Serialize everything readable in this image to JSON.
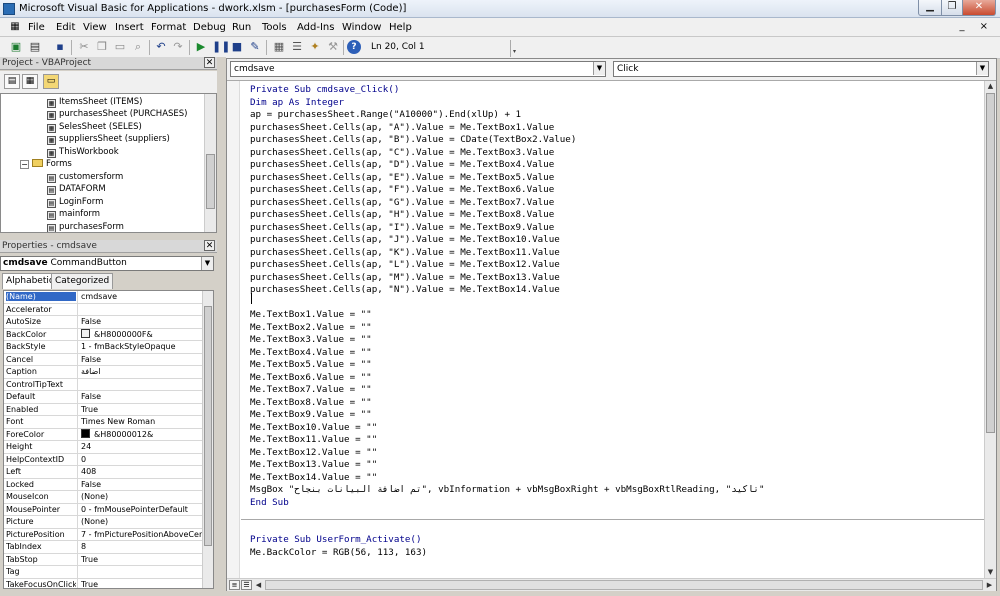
{
  "window": {
    "title": "Microsoft Visual Basic for Applications - dwork.xlsm - [purchasesForm (Code)]"
  },
  "menu": {
    "items": [
      "File",
      "Edit",
      "View",
      "Insert",
      "Format",
      "Debug",
      "Run",
      "Tools",
      "Add-Ins",
      "Window",
      "Help"
    ],
    "mdi_controls": "_ ×"
  },
  "toolbar": {
    "position": "Ln 20, Col 1"
  },
  "project": {
    "title": "Project - VBAProject",
    "items": [
      {
        "label": "ItemsSheet (ITEMS)"
      },
      {
        "label": "purchasesSheet (PURCHASES)"
      },
      {
        "label": "SelesSheet (SELES)"
      },
      {
        "label": "suppliersSheet (suppliers)"
      },
      {
        "label": "ThisWorkbook"
      },
      {
        "label": "Forms"
      },
      {
        "label": "customersform"
      },
      {
        "label": "DATAFORM"
      },
      {
        "label": "LoginForm"
      },
      {
        "label": "mainform"
      },
      {
        "label": "purchasesForm"
      }
    ]
  },
  "properties": {
    "title": "Properties - cmdsave",
    "object_name": "cmdsave",
    "object_type": "CommandButton",
    "tabs": [
      "Alphabetic",
      "Categorized"
    ],
    "rows": [
      {
        "name": "(Name)",
        "value": "cmdsave"
      },
      {
        "name": "Accelerator",
        "value": ""
      },
      {
        "name": "AutoSize",
        "value": "False"
      },
      {
        "name": "BackColor",
        "value": "&H8000000F&"
      },
      {
        "name": "BackStyle",
        "value": "1 - fmBackStyleOpaque"
      },
      {
        "name": "Cancel",
        "value": "False"
      },
      {
        "name": "Caption",
        "value": "اضافة"
      },
      {
        "name": "ControlTipText",
        "value": ""
      },
      {
        "name": "Default",
        "value": "False"
      },
      {
        "name": "Enabled",
        "value": "True"
      },
      {
        "name": "Font",
        "value": "Times New Roman"
      },
      {
        "name": "ForeColor",
        "value": "&H80000012&"
      },
      {
        "name": "Height",
        "value": "24"
      },
      {
        "name": "HelpContextID",
        "value": "0"
      },
      {
        "name": "Left",
        "value": "408"
      },
      {
        "name": "Locked",
        "value": "False"
      },
      {
        "name": "MouseIcon",
        "value": "(None)"
      },
      {
        "name": "MousePointer",
        "value": "0 - fmMousePointerDefault"
      },
      {
        "name": "Picture",
        "value": "(None)"
      },
      {
        "name": "PicturePosition",
        "value": "7 - fmPicturePositionAboveCenter"
      },
      {
        "name": "TabIndex",
        "value": "8"
      },
      {
        "name": "TabStop",
        "value": "True"
      },
      {
        "name": "Tag",
        "value": ""
      },
      {
        "name": "TakeFocusOnClick",
        "value": "True"
      }
    ]
  },
  "code": {
    "object_combo": "cmdsave",
    "proc_combo": "Click",
    "lines": [
      "Private Sub cmdsave_Click()",
      "Dim ap As Integer",
      "ap = purchasesSheet.Range(\"A10000\").End(xlUp) + 1",
      "purchasesSheet.Cells(ap, \"A\").Value = Me.TextBox1.Value",
      "purchasesSheet.Cells(ap, \"B\").Value = CDate(TextBox2.Value)",
      "purchasesSheet.Cells(ap, \"C\").Value = Me.TextBox3.Value",
      "purchasesSheet.Cells(ap, \"D\").Value = Me.TextBox4.Value",
      "purchasesSheet.Cells(ap, \"E\").Value = Me.TextBox5.Value",
      "purchasesSheet.Cells(ap, \"F\").Value = Me.TextBox6.Value",
      "purchasesSheet.Cells(ap, \"G\").Value = Me.TextBox7.Value",
      "purchasesSheet.Cells(ap, \"H\").Value = Me.TextBox8.Value",
      "purchasesSheet.Cells(ap, \"I\").Value = Me.TextBox9.Value",
      "purchasesSheet.Cells(ap, \"J\").Value = Me.TextBox10.Value",
      "purchasesSheet.Cells(ap, \"K\").Value = Me.TextBox11.Value",
      "purchasesSheet.Cells(ap, \"L\").Value = Me.TextBox12.Value",
      "purchasesSheet.Cells(ap, \"M\").Value = Me.TextBox13.Value",
      "purchasesSheet.Cells(ap, \"N\").Value = Me.TextBox14.Value",
      "",
      "Me.TextBox1.Value = \"\"",
      "Me.TextBox2.Value = \"\"",
      "Me.TextBox3.Value = \"\"",
      "Me.TextBox4.Value = \"\"",
      "Me.TextBox5.Value = \"\"",
      "Me.TextBox6.Value = \"\"",
      "Me.TextBox7.Value = \"\"",
      "Me.TextBox8.Value = \"\"",
      "Me.TextBox9.Value = \"\"",
      "Me.TextBox10.Value = \"\"",
      "Me.TextBox11.Value = \"\"",
      "Me.TextBox12.Value = \"\"",
      "Me.TextBox13.Value = \"\"",
      "Me.TextBox14.Value = \"\"",
      "MsgBox \"تم اضافة البيانات بنجاح\", vbInformation + vbMsgBoxRight + vbMsgBoxRtlReading, \"تاكيد\"",
      "End Sub",
      "",
      "",
      "Private Sub UserForm_Activate()",
      "Me.BackColor = RGB(56, 113, 163)"
    ]
  }
}
